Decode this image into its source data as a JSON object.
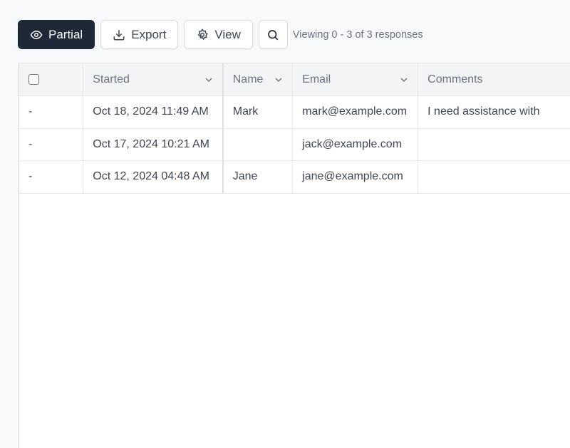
{
  "toolbar": {
    "partial_label": "Partial",
    "export_label": "Export",
    "view_label": "View",
    "viewing_text": "Viewing 0 - 3 of 3 responses"
  },
  "table": {
    "columns": [
      {
        "label": "Started",
        "sortable": true
      },
      {
        "label": "Name",
        "sortable": true
      },
      {
        "label": "Email",
        "sortable": true
      },
      {
        "label": "Comments",
        "sortable": false
      }
    ],
    "rows": [
      {
        "select": "-",
        "started": "Oct 18, 2024 11:49 AM",
        "name": "Mark",
        "email": "mark@example.com",
        "comments": "I need assistance with"
      },
      {
        "select": "-",
        "started": "Oct 17, 2024 10:21 AM",
        "name": "",
        "email": "jack@example.com",
        "comments": ""
      },
      {
        "select": "-",
        "started": "Oct 12, 2024 04:48 AM",
        "name": "Jane",
        "email": "jane@example.com",
        "comments": ""
      }
    ]
  }
}
